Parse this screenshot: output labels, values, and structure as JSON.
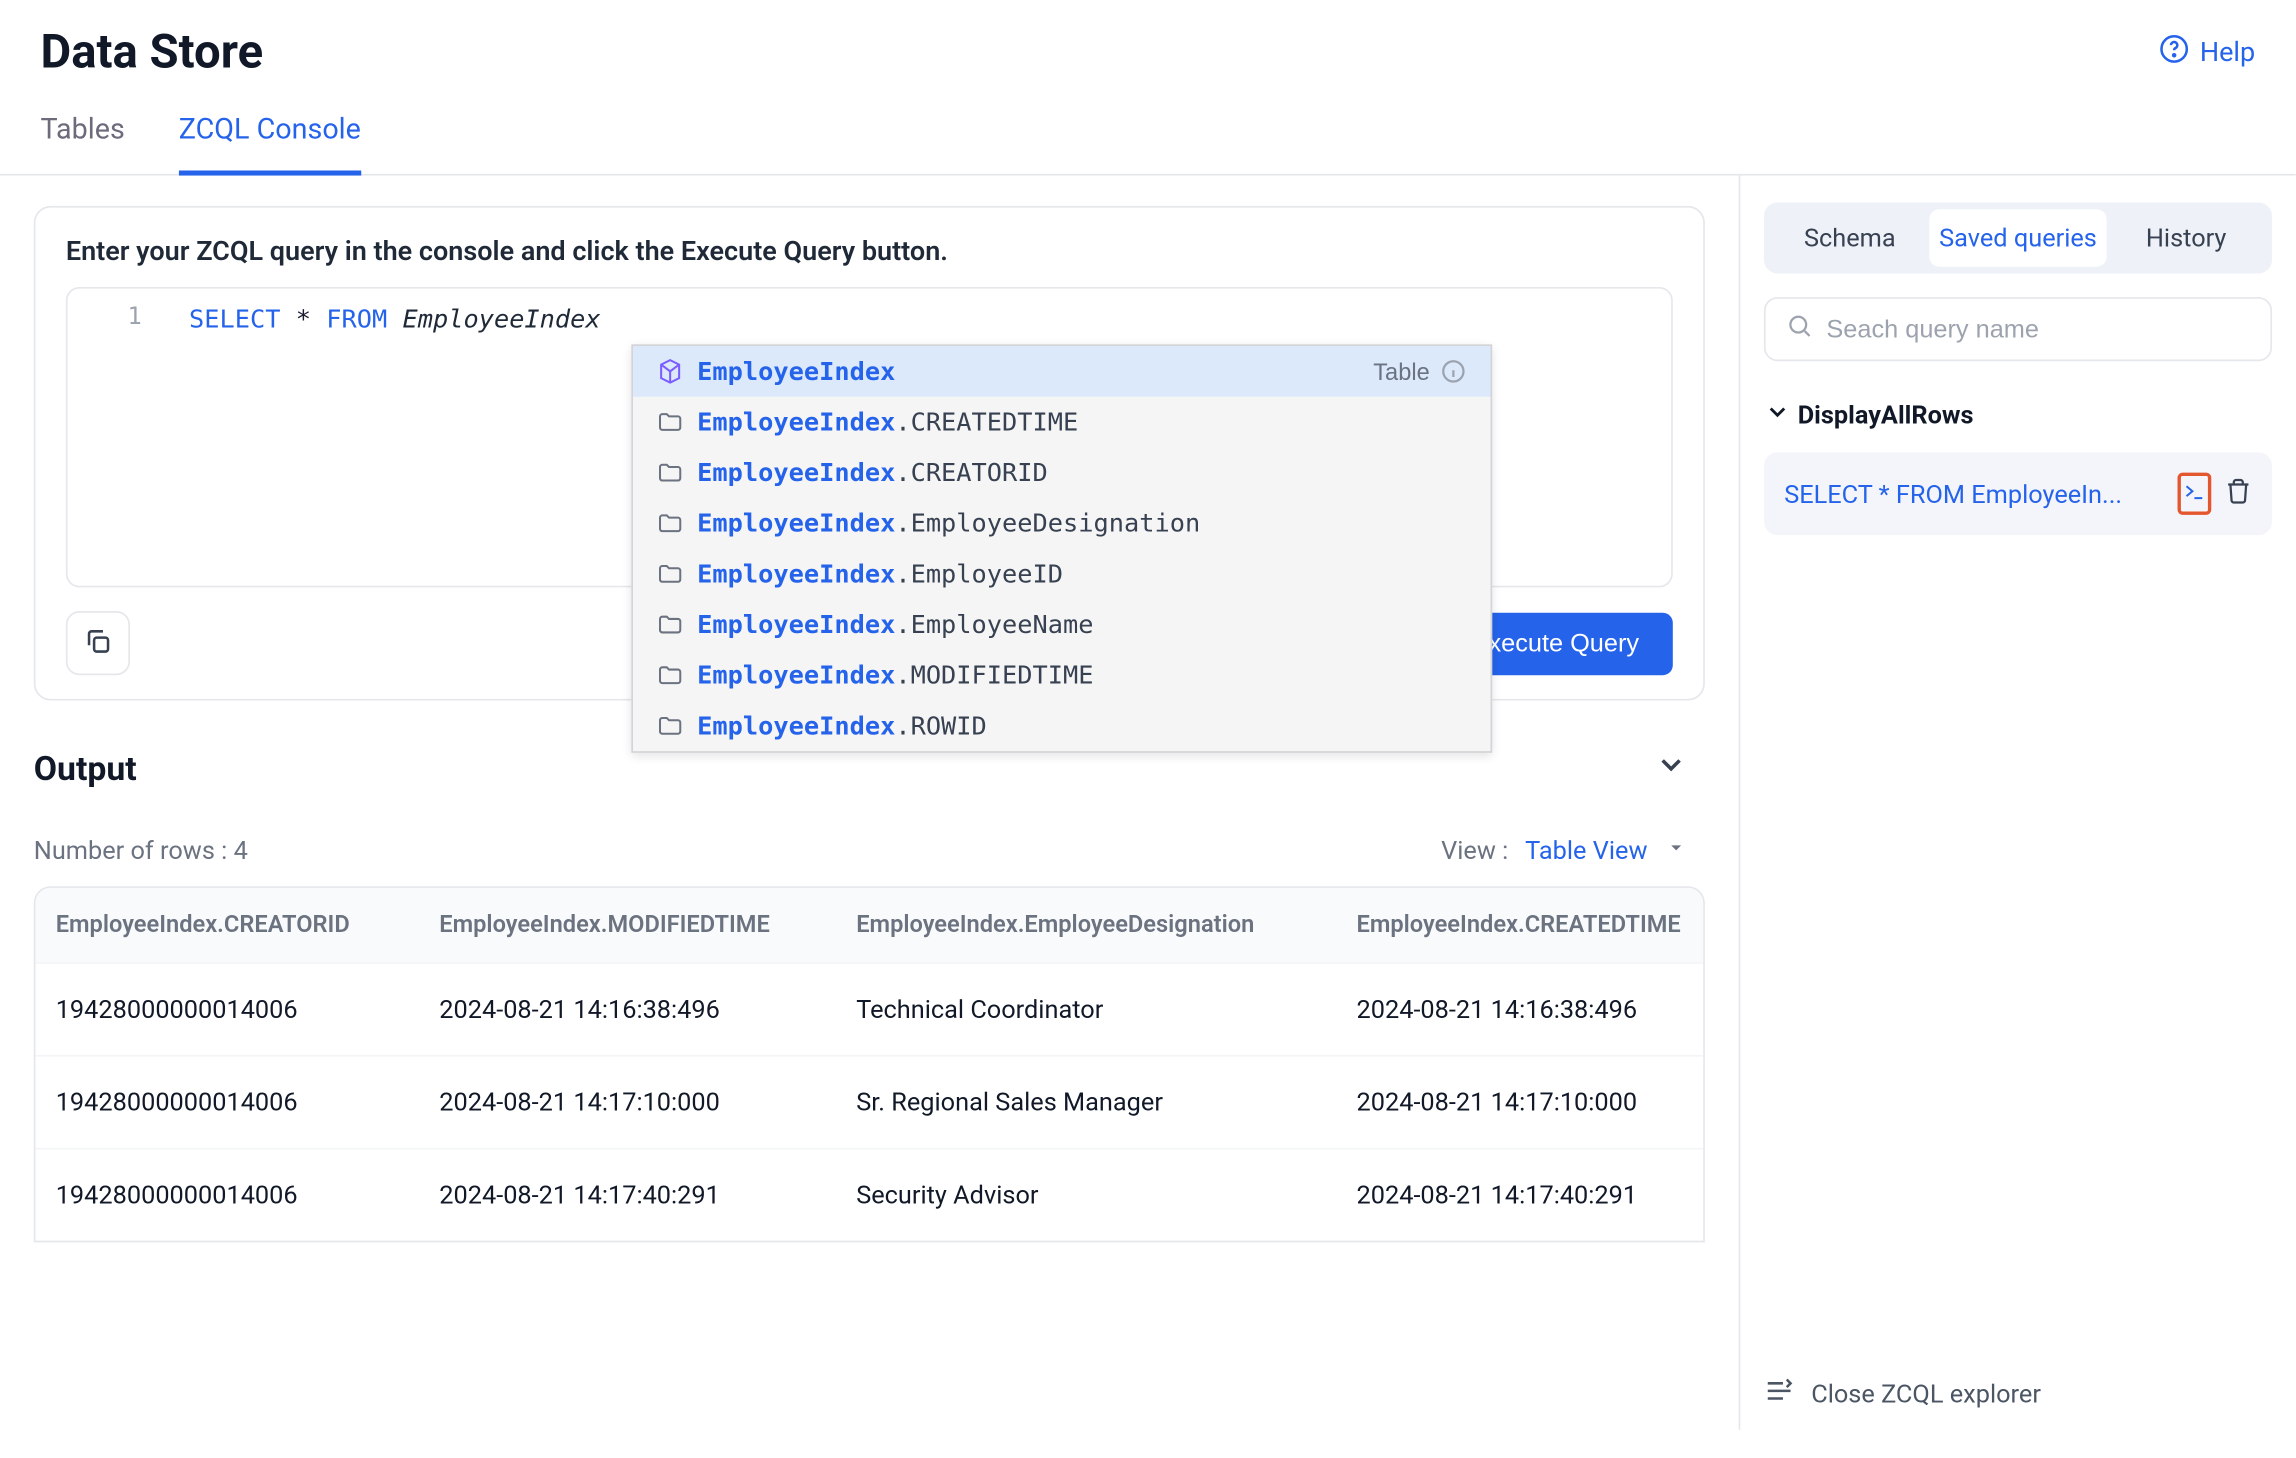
{
  "header": {
    "title": "Data Store",
    "help_label": "Help"
  },
  "tabs": {
    "tables": "Tables",
    "zcql": "ZCQL Console"
  },
  "query_card": {
    "prompt": "Enter your ZCQL query in the console and click the Execute Query button.",
    "line_number": "1",
    "token_select": "SELECT",
    "token_star": " * ",
    "token_from": "FROM",
    "token_space": " ",
    "token_ident": "EmployeeIndex",
    "execute_label": "Execute Query"
  },
  "autocomplete": {
    "meta_label": "Table",
    "rows": [
      {
        "table": "EmployeeIndex",
        "col": "",
        "selected": true,
        "is_table": true
      },
      {
        "table": "EmployeeIndex",
        "col": ".CREATEDTIME"
      },
      {
        "table": "EmployeeIndex",
        "col": ".CREATORID"
      },
      {
        "table": "EmployeeIndex",
        "col": ".EmployeeDesignation"
      },
      {
        "table": "EmployeeIndex",
        "col": ".EmployeeID"
      },
      {
        "table": "EmployeeIndex",
        "col": ".EmployeeName"
      },
      {
        "table": "EmployeeIndex",
        "col": ".MODIFIEDTIME"
      },
      {
        "table": "EmployeeIndex",
        "col": ".ROWID"
      }
    ]
  },
  "output": {
    "title": "Output",
    "rows_label": "Number of rows : 4",
    "view_label": "View :",
    "view_value": "Table View",
    "columns": [
      "EmployeeIndex.CREATORID",
      "EmployeeIndex.MODIFIEDTIME",
      "EmployeeIndex.EmployeeDesignation",
      "EmployeeIndex.CREATEDTIME"
    ],
    "rows": [
      [
        "19428000000014006",
        "2024-08-21 14:16:38:496",
        "Technical Coordinator",
        "2024-08-21 14:16:38:496"
      ],
      [
        "19428000000014006",
        "2024-08-21 14:17:10:000",
        "Sr. Regional Sales Manager",
        "2024-08-21 14:17:10:000"
      ],
      [
        "19428000000014006",
        "2024-08-21 14:17:40:291",
        "Security Advisor",
        "2024-08-21 14:17:40:291"
      ]
    ]
  },
  "sidebar": {
    "tabs": {
      "schema": "Schema",
      "saved": "Saved queries",
      "history": "History"
    },
    "search_placeholder": "Seach query name",
    "group_label": "DisplayAllRows",
    "saved_query_text": "SELECT * FROM EmployeeIn...",
    "close_label": "Close ZCQL explorer"
  }
}
